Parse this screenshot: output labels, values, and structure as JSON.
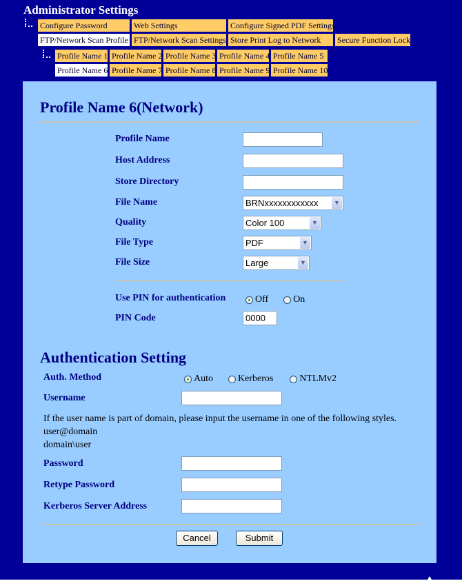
{
  "header": {
    "title": "Administrator Settings"
  },
  "nav": {
    "row1": [
      {
        "label": "Configure Password",
        "active": false
      },
      {
        "label": "Web Settings",
        "active": false
      },
      {
        "label": "Configure Signed PDF Settings",
        "active": false
      }
    ],
    "row2": [
      {
        "label": "FTP/Network Scan Profile",
        "active": true
      },
      {
        "label": "FTP/Network Scan Settings",
        "active": false
      },
      {
        "label": "Store Print Log to Network",
        "active": false
      },
      {
        "label": "Secure Function Lock",
        "active": false
      }
    ],
    "profiles_row1": [
      {
        "label": "Profile Name 1",
        "active": false
      },
      {
        "label": "Profile Name 2",
        "active": false
      },
      {
        "label": "Profile Name 3",
        "active": false
      },
      {
        "label": "Profile Name 4",
        "active": false
      },
      {
        "label": "Profile Name 5",
        "active": false
      }
    ],
    "profiles_row2": [
      {
        "label": "Profile Name 6",
        "active": true
      },
      {
        "label": "Profile Name 7",
        "active": false
      },
      {
        "label": "Profile Name 8",
        "active": false
      },
      {
        "label": "Profile Name 9",
        "active": false
      },
      {
        "label": "Profile Name 10",
        "active": false
      }
    ]
  },
  "profile": {
    "heading": "Profile Name 6(Network)",
    "fields": {
      "profile_name": {
        "label": "Profile Name",
        "value": ""
      },
      "host_address": {
        "label": "Host Address",
        "value": ""
      },
      "store_directory": {
        "label": "Store Directory",
        "value": ""
      },
      "file_name": {
        "label": "File Name",
        "value": "BRNxxxxxxxxxxxx"
      },
      "quality": {
        "label": "Quality",
        "value": "Color 100"
      },
      "file_type": {
        "label": "File Type",
        "value": "PDF"
      },
      "file_size": {
        "label": "File Size",
        "value": "Large"
      }
    },
    "use_pin": {
      "label": "Use PIN for authentication",
      "options": [
        "Off",
        "On"
      ],
      "selected": "Off"
    },
    "pin_code": {
      "label": "PIN Code",
      "value": "0000"
    }
  },
  "auth": {
    "heading": "Authentication Setting",
    "method": {
      "label": "Auth. Method",
      "options": [
        "Auto",
        "Kerberos",
        "NTLMv2"
      ],
      "selected": "Auto"
    },
    "username": {
      "label": "Username",
      "value": ""
    },
    "note": "If the user name is part of domain, please input the username in one of the following styles.",
    "style1": "user@domain",
    "style2": "domain\\user",
    "password": {
      "label": "Password",
      "value": ""
    },
    "retype_password": {
      "label": "Retype Password",
      "value": ""
    },
    "kerberos_server": {
      "label": "Kerberos Server Address",
      "value": ""
    }
  },
  "buttons": {
    "cancel": "Cancel",
    "submit": "Submit"
  },
  "icons": {
    "dropdown": "chevron-down-icon",
    "tree": "tree-connector-icon"
  },
  "colors": {
    "background": "#000099",
    "panel": "#99ccff",
    "tab": "#ffcc66",
    "tab_active": "#ffffff",
    "heading": "#000080"
  }
}
